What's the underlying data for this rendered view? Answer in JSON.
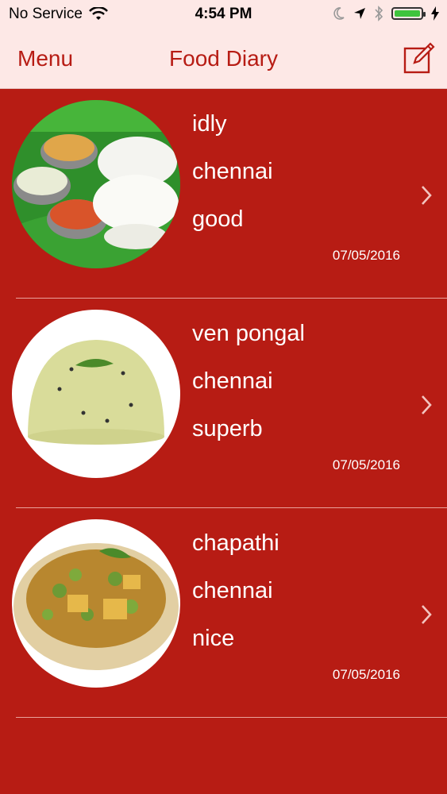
{
  "status_bar": {
    "carrier": "No Service",
    "time": "4:54 PM"
  },
  "nav": {
    "menu_label": "Menu",
    "title": "Food Diary"
  },
  "entries": [
    {
      "name": "idly",
      "location": "chennai",
      "rating": "good",
      "date": "07/05/2016"
    },
    {
      "name": "ven pongal",
      "location": "chennai",
      "rating": "superb",
      "date": "07/05/2016"
    },
    {
      "name": "chapathi",
      "location": "chennai",
      "rating": "nice",
      "date": "07/05/2016"
    }
  ],
  "colors": {
    "background": "#b71c14",
    "nav_background": "#fde8e6",
    "accent": "#b71c14"
  }
}
